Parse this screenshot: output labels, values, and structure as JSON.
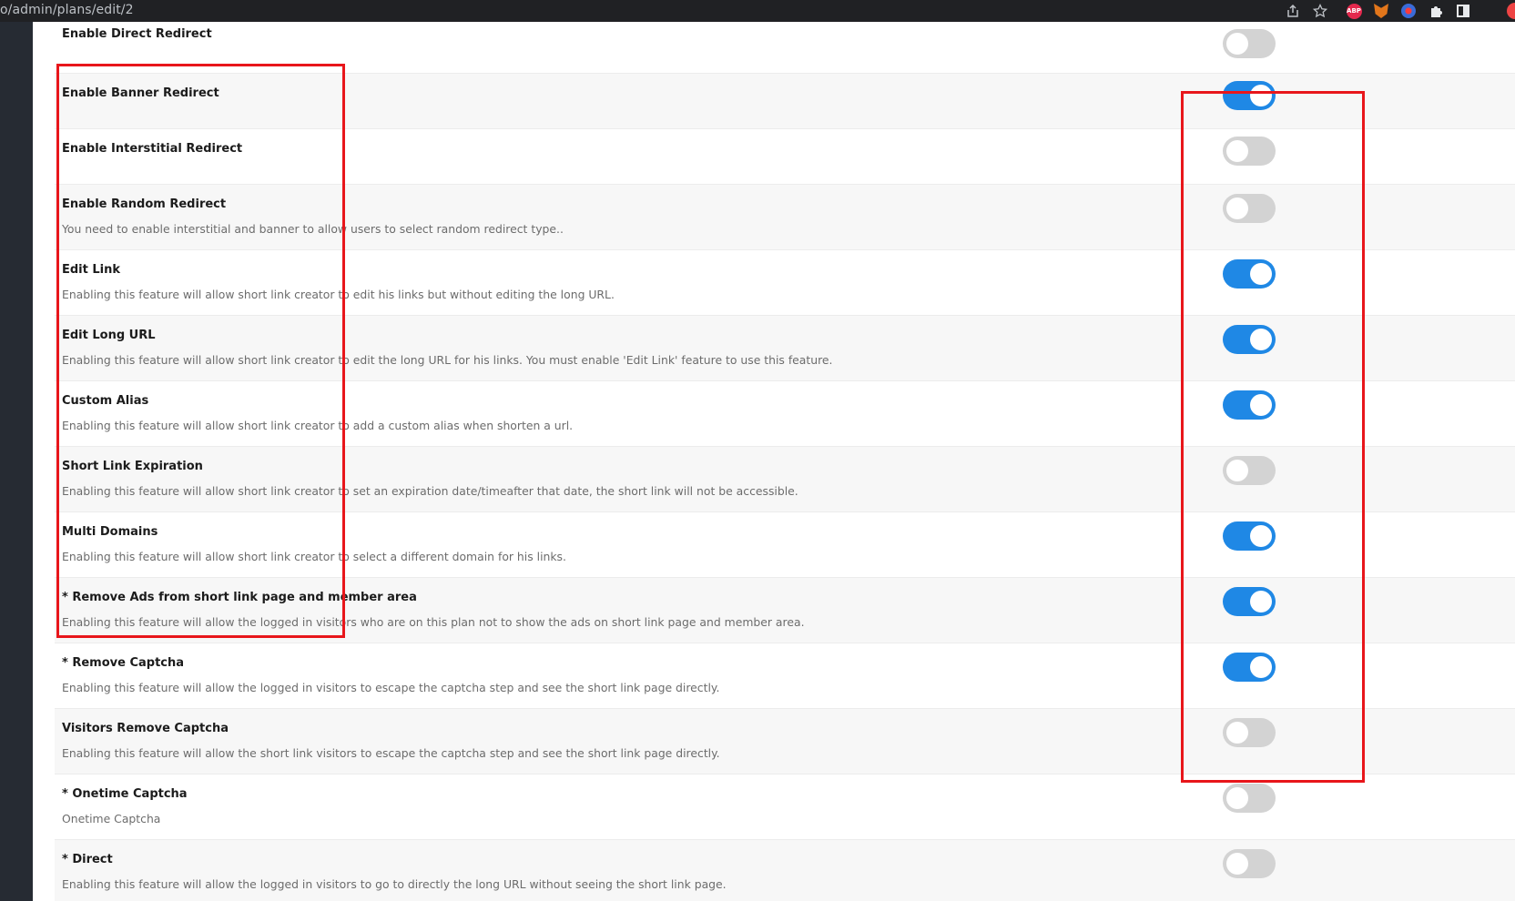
{
  "browser": {
    "url": "o/admin/plans/edit/2",
    "icons": [
      "share-icon",
      "star-icon",
      "adblock-plus-icon",
      "metamask-fox-icon",
      "globe-extension-icon",
      "puzzle-extensions-icon",
      "side-panel-icon",
      "profile-avatar"
    ],
    "abp_label": "ABP"
  },
  "colors": {
    "toggle_on": "#1f88e5",
    "toggle_off": "#d3d3d3",
    "highlight": "#e8161b",
    "sidebar": "#262b33"
  },
  "features": [
    {
      "title": "Enable Direct Redirect",
      "desc": "",
      "enabled": false
    },
    {
      "title": "Enable Banner Redirect",
      "desc": "",
      "enabled": true
    },
    {
      "title": "Enable Interstitial Redirect",
      "desc": "",
      "enabled": false
    },
    {
      "title": "Enable Random Redirect",
      "desc": "You need to enable interstitial and banner to allow users to select random redirect type..",
      "enabled": false
    },
    {
      "title": "Edit Link",
      "desc": "Enabling this feature will allow short link creator to edit his links but without editing the long URL.",
      "enabled": true
    },
    {
      "title": "Edit Long URL",
      "desc": "Enabling this feature will allow short link creator to edit the long URL for his links. You must enable 'Edit Link' feature to use this feature.",
      "enabled": true
    },
    {
      "title": "Custom Alias",
      "desc": "Enabling this feature will allow short link creator to add a custom alias when shorten a url.",
      "enabled": true
    },
    {
      "title": "Short Link Expiration",
      "desc": "Enabling this feature will allow short link creator to set an expiration date/timeafter that date, the short link will not be accessible.",
      "enabled": false
    },
    {
      "title": "Multi Domains",
      "desc": "Enabling this feature will allow short link creator to select a different domain for his links.",
      "enabled": true
    },
    {
      "title": "* Remove Ads from short link page and member area",
      "desc": "Enabling this feature will allow the logged in visitors who are on this plan not to show the ads on short link page and member area.",
      "enabled": true
    },
    {
      "title": "* Remove Captcha",
      "desc": "Enabling this feature will allow the logged in visitors to escape the captcha step and see the short link page directly.",
      "enabled": true
    },
    {
      "title": "Visitors Remove Captcha",
      "desc": "Enabling this feature will allow the short link visitors to escape the captcha step and see the short link page directly.",
      "enabled": false
    },
    {
      "title": "* Onetime Captcha",
      "desc": "Onetime Captcha",
      "enabled": false
    },
    {
      "title": "* Direct",
      "desc": "Enabling this feature will allow the logged in visitors to go to directly the long URL without seeing the short link page.",
      "enabled": false
    }
  ]
}
